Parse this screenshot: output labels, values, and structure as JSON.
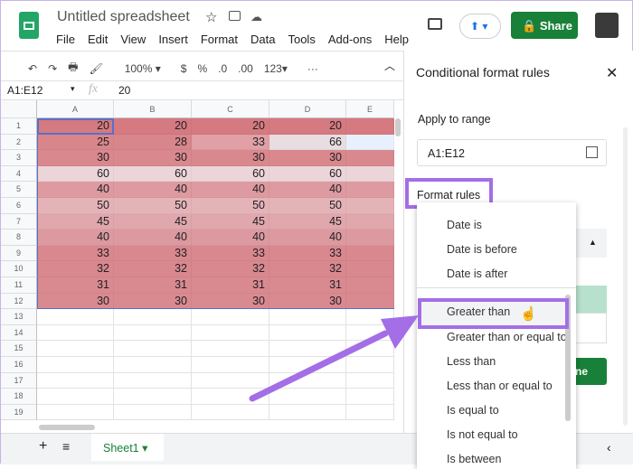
{
  "app": {
    "title": "Untitled spreadsheet",
    "menu": [
      "File",
      "Edit",
      "View",
      "Insert",
      "Format",
      "Data",
      "Tools",
      "Add-ons",
      "Help"
    ],
    "share_label": "Share"
  },
  "toolbar": {
    "zoom": "100%",
    "currency": "$",
    "percent": "%",
    "dec_less": ".0",
    "dec_more": ".00",
    "format_more": "123▾",
    "more": "···"
  },
  "formula": {
    "name_box": "A1:E12",
    "fx": "fx",
    "value": "20"
  },
  "columns": [
    "A",
    "B",
    "C",
    "D",
    "E"
  ],
  "rows": [
    [
      "20",
      "20",
      "20",
      "20"
    ],
    [
      "25",
      "28",
      "33",
      "66"
    ],
    [
      "30",
      "30",
      "30",
      "30"
    ],
    [
      "60",
      "60",
      "60",
      "60"
    ],
    [
      "40",
      "40",
      "40",
      "40"
    ],
    [
      "50",
      "50",
      "50",
      "50"
    ],
    [
      "45",
      "45",
      "45",
      "45"
    ],
    [
      "40",
      "40",
      "40",
      "40"
    ],
    [
      "33",
      "33",
      "33",
      "33"
    ],
    [
      "32",
      "32",
      "32",
      "32"
    ],
    [
      "31",
      "31",
      "31",
      "31"
    ],
    [
      "30",
      "30",
      "30",
      "30"
    ]
  ],
  "row_count": 19,
  "sheet_tab": "Sheet1",
  "panel": {
    "title": "Conditional format rules",
    "apply_label": "Apply to range",
    "range": "A1:E12",
    "format_rules_label": "Format rules",
    "done_partial": "ne"
  },
  "dropdown": {
    "items": [
      "Date is",
      "Date is before",
      "Date is after",
      "Greater than",
      "Greater than or equal to",
      "Less than",
      "Less than or equal to",
      "Is equal to",
      "Is not equal to",
      "Is between"
    ],
    "highlighted": "Greater than"
  },
  "colors": {
    "accent_purple": "#a36ee6",
    "sheets_green": "#188038",
    "highlight_row1": "#d57a80"
  }
}
